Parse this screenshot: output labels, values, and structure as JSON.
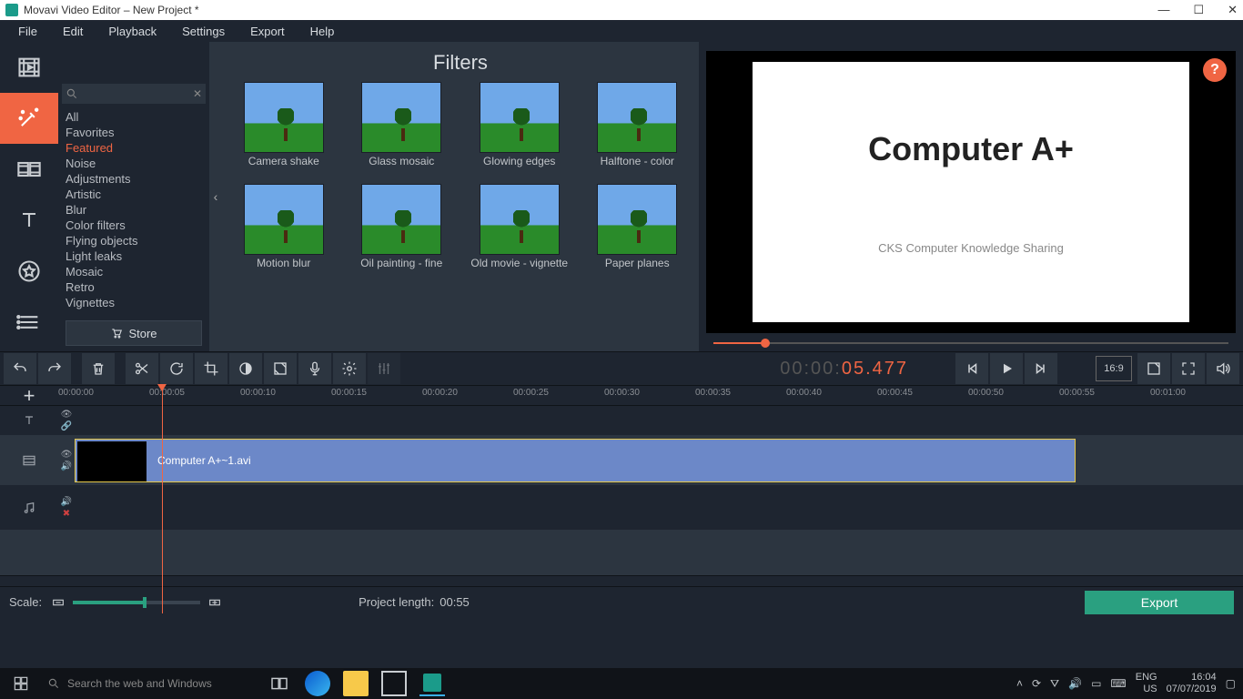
{
  "titlebar": {
    "app": "Movavi Video Editor",
    "project": "New Project *"
  },
  "menu": [
    "File",
    "Edit",
    "Playback",
    "Settings",
    "Export",
    "Help"
  ],
  "categories": [
    "All",
    "Favorites",
    "Featured",
    "Noise",
    "Adjustments",
    "Artistic",
    "Blur",
    "Color filters",
    "Flying objects",
    "Light leaks",
    "Mosaic",
    "Retro",
    "Vignettes"
  ],
  "category_selected": "Featured",
  "store_label": "Store",
  "panel_title": "Filters",
  "filters": [
    {
      "label": "Camera shake"
    },
    {
      "label": "Glass mosaic"
    },
    {
      "label": "Glowing edges"
    },
    {
      "label": "Halftone - color"
    },
    {
      "label": "Motion blur"
    },
    {
      "label": "Oil painting - fine"
    },
    {
      "label": "Old movie - vignette"
    },
    {
      "label": "Paper planes"
    }
  ],
  "preview": {
    "heading": "Computer A+",
    "sub": "CKS Computer Knowledge Sharing"
  },
  "timecode": {
    "gray": "00:00:",
    "main": "05.477"
  },
  "aspect": "16:9",
  "ruler_marks": [
    "00:00:00",
    "00:00:05",
    "00:00:10",
    "00:00:15",
    "00:00:20",
    "00:00:25",
    "00:00:30",
    "00:00:35",
    "00:00:40",
    "00:00:45",
    "00:00:50",
    "00:00:55",
    "00:01:00"
  ],
  "clip": {
    "name": "Computer A+~1.avi"
  },
  "bottom": {
    "scale_label": "Scale:",
    "project_length_label": "Project length:",
    "project_length": "00:55",
    "export": "Export"
  },
  "taskbar": {
    "search_placeholder": "Search the web and Windows",
    "lang1": "ENG",
    "lang2": "US",
    "time": "16:04",
    "date": "07/07/2019"
  }
}
